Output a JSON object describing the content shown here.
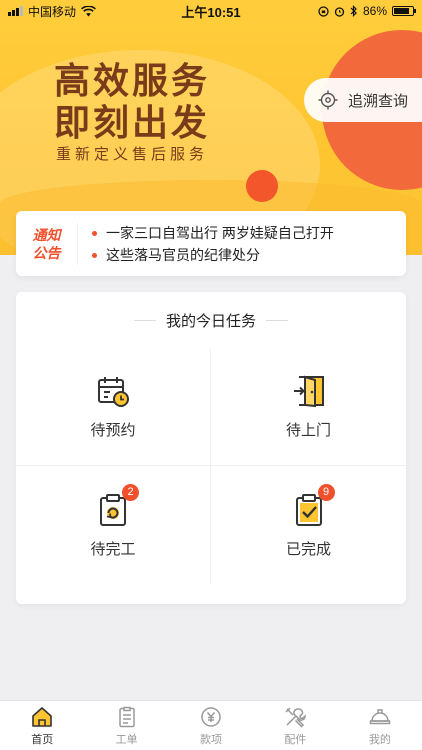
{
  "status_bar": {
    "carrier": "中国移动",
    "time": "上午10:51",
    "battery": "86%",
    "battery_level": 0.86
  },
  "hero": {
    "slogan_line1": "高效服务",
    "slogan_line2": "即刻出发",
    "subtitle": "重新定义售后服务",
    "trace_button": "追溯查询",
    "trace_icon": "crosshair-icon"
  },
  "notice": {
    "badge_line1": "通知",
    "badge_line2": "公告",
    "items": [
      "一家三口自驾出行 两岁娃疑自己打开",
      "这些落马官员的纪律处分"
    ]
  },
  "tasks": {
    "title": "我的今日任务",
    "items": [
      {
        "label": "待预约",
        "icon": "calendar-clock-icon",
        "badge": ""
      },
      {
        "label": "待上门",
        "icon": "door-enter-icon",
        "badge": ""
      },
      {
        "label": "待完工",
        "icon": "clipboard-refresh-icon",
        "badge": "2"
      },
      {
        "label": "已完成",
        "icon": "clipboard-check-icon",
        "badge": "9"
      }
    ]
  },
  "tabbar": {
    "tabs": [
      {
        "label": "首页",
        "icon": "home-icon",
        "active": true
      },
      {
        "label": "工单",
        "icon": "work-order-icon",
        "active": false
      },
      {
        "label": "款项",
        "icon": "payment-icon",
        "active": false
      },
      {
        "label": "配件",
        "icon": "tools-icon",
        "active": false
      },
      {
        "label": "我的",
        "icon": "helmet-icon",
        "active": false
      }
    ]
  },
  "colors": {
    "primary_yellow": "#ffc531",
    "accent_orange": "#f0502c",
    "slogan_brown": "#7a3b1a"
  }
}
